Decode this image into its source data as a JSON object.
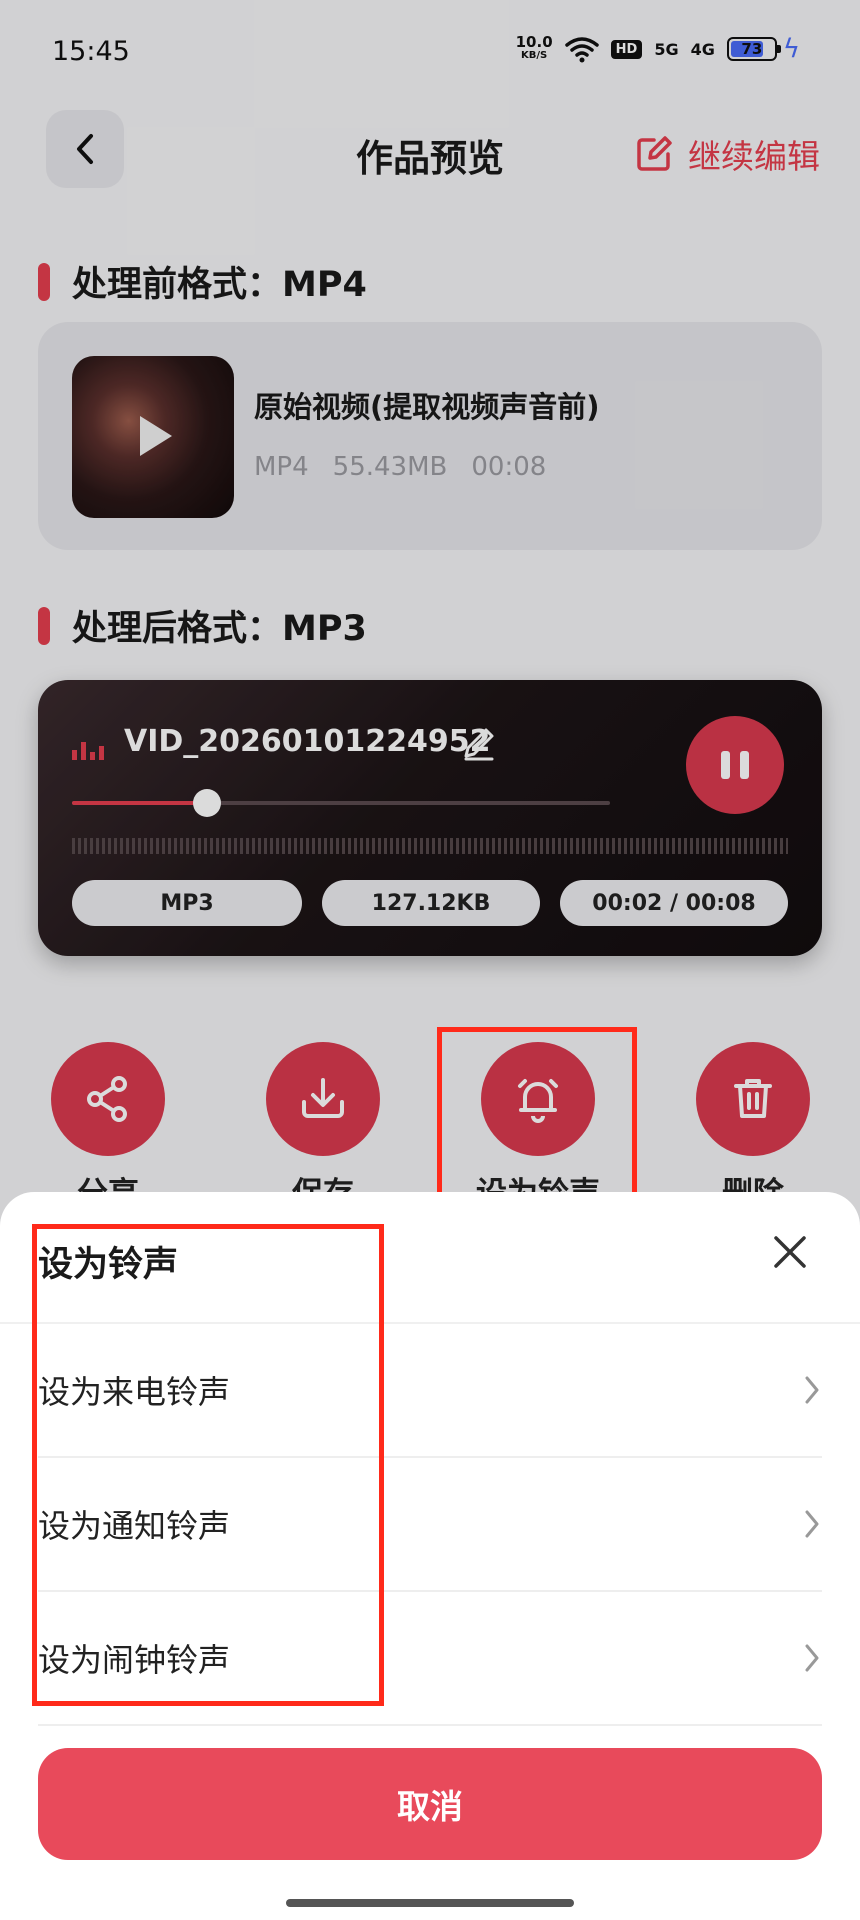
{
  "status_bar": {
    "time": "15:45",
    "net_speed_value": "10.0",
    "net_speed_unit": "KB/S",
    "hd_badge": "HD",
    "signal_1": "5G",
    "signal_2": "4G",
    "battery": "73"
  },
  "header": {
    "title": "作品预览",
    "edit_label": "继续编辑"
  },
  "before": {
    "section_title": "处理前格式：MP4",
    "name": "原始视频(提取视频声音前)",
    "format": "MP4",
    "size": "55.43MB",
    "duration": "00:08"
  },
  "after": {
    "section_title": "处理后格式：MP3",
    "file_name": "VID_20260101224952",
    "format": "MP3",
    "size": "127.12KB",
    "time": "00:02 / 00:08",
    "progress": 0.25
  },
  "actions": [
    {
      "label": "分享",
      "icon": "share-icon"
    },
    {
      "label": "保存",
      "icon": "download-icon"
    },
    {
      "label": "设为铃声",
      "icon": "bell-icon"
    },
    {
      "label": "删除",
      "icon": "trash-icon"
    }
  ],
  "sheet": {
    "title": "设为铃声",
    "items": [
      {
        "label": "设为来电铃声"
      },
      {
        "label": "设为通知铃声"
      },
      {
        "label": "设为闹钟铃声"
      }
    ],
    "cancel_label": "取消"
  },
  "colors": {
    "accent": "#e53e4e",
    "highlight": "#ff2a1a"
  }
}
